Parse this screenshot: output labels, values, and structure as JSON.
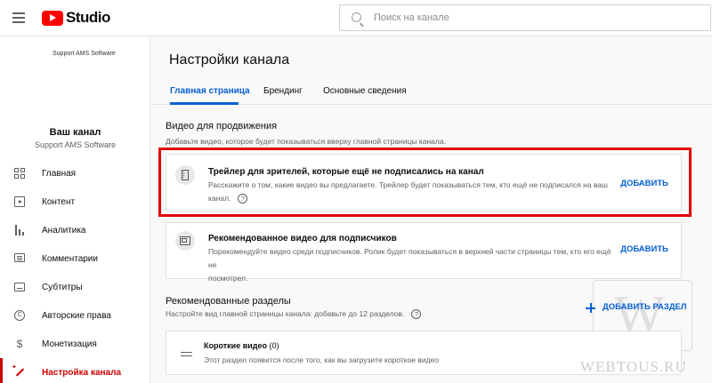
{
  "header": {
    "logo_text": "Studio",
    "search_placeholder": "Поиск на канале"
  },
  "sidebar": {
    "avatar_alt_text": "Support AMS Software",
    "channel_title": "Ваш канал",
    "channel_name": "Support AMS Software",
    "items": [
      {
        "label": "Главная",
        "icon": "dashboard-icon"
      },
      {
        "label": "Контент",
        "icon": "content-icon"
      },
      {
        "label": "Аналитика",
        "icon": "analytics-icon"
      },
      {
        "label": "Комментарии",
        "icon": "comments-icon"
      },
      {
        "label": "Субтитры",
        "icon": "subtitles-icon"
      },
      {
        "label": "Авторские права",
        "icon": "copyright-icon"
      },
      {
        "label": "Монетизация",
        "icon": "dollar-icon"
      },
      {
        "label": "Настройка канала",
        "icon": "customization-icon",
        "active": true
      }
    ]
  },
  "main": {
    "page_title": "Настройки канала",
    "tabs": [
      {
        "label": "Главная страница",
        "active": true
      },
      {
        "label": "Брендинг"
      },
      {
        "label": "Основные сведения"
      }
    ],
    "promo": {
      "title": "Видео для продвижения",
      "subtitle": "Добавьте видео, которое будет показываться вверху главной страницы канала.",
      "trailer": {
        "title": "Трейлер для зрителей, которые ещё не подписались на канал",
        "desc_line1": "Расскажите о том, какие видео вы предлагаете. Трейлер будет показываться тем, кто ещё не подписался на ваш",
        "desc_line2": "канал.",
        "action": "ДОБАВИТЬ"
      },
      "featured": {
        "title": "Рекомендованное видео для подписчиков",
        "desc_line1": "Порекомендуйте видео среди подписчиков. Ролик будет показываться в верхней части страницы тем, кто его ещё не",
        "desc_line2": "посмотрел.",
        "action": "ДОБАВИТЬ"
      }
    },
    "sections": {
      "title": "Рекомендованные разделы",
      "subtitle": "Настройте вид главной страницы канала: добавьте до 12 разделов.",
      "add_label": "ДОБАВИТЬ РАЗДЕЛ",
      "short_videos": {
        "title": "Короткие видео",
        "count": "(0)",
        "desc": "Этот раздел появится после того, как вы загрузите короткое видео"
      }
    }
  },
  "watermark": {
    "letter": "W",
    "text": "WEBTOUS.RU"
  },
  "colors": {
    "accent": "#065fd4",
    "brand_red": "#ff0000",
    "highlight": "#e20000"
  }
}
